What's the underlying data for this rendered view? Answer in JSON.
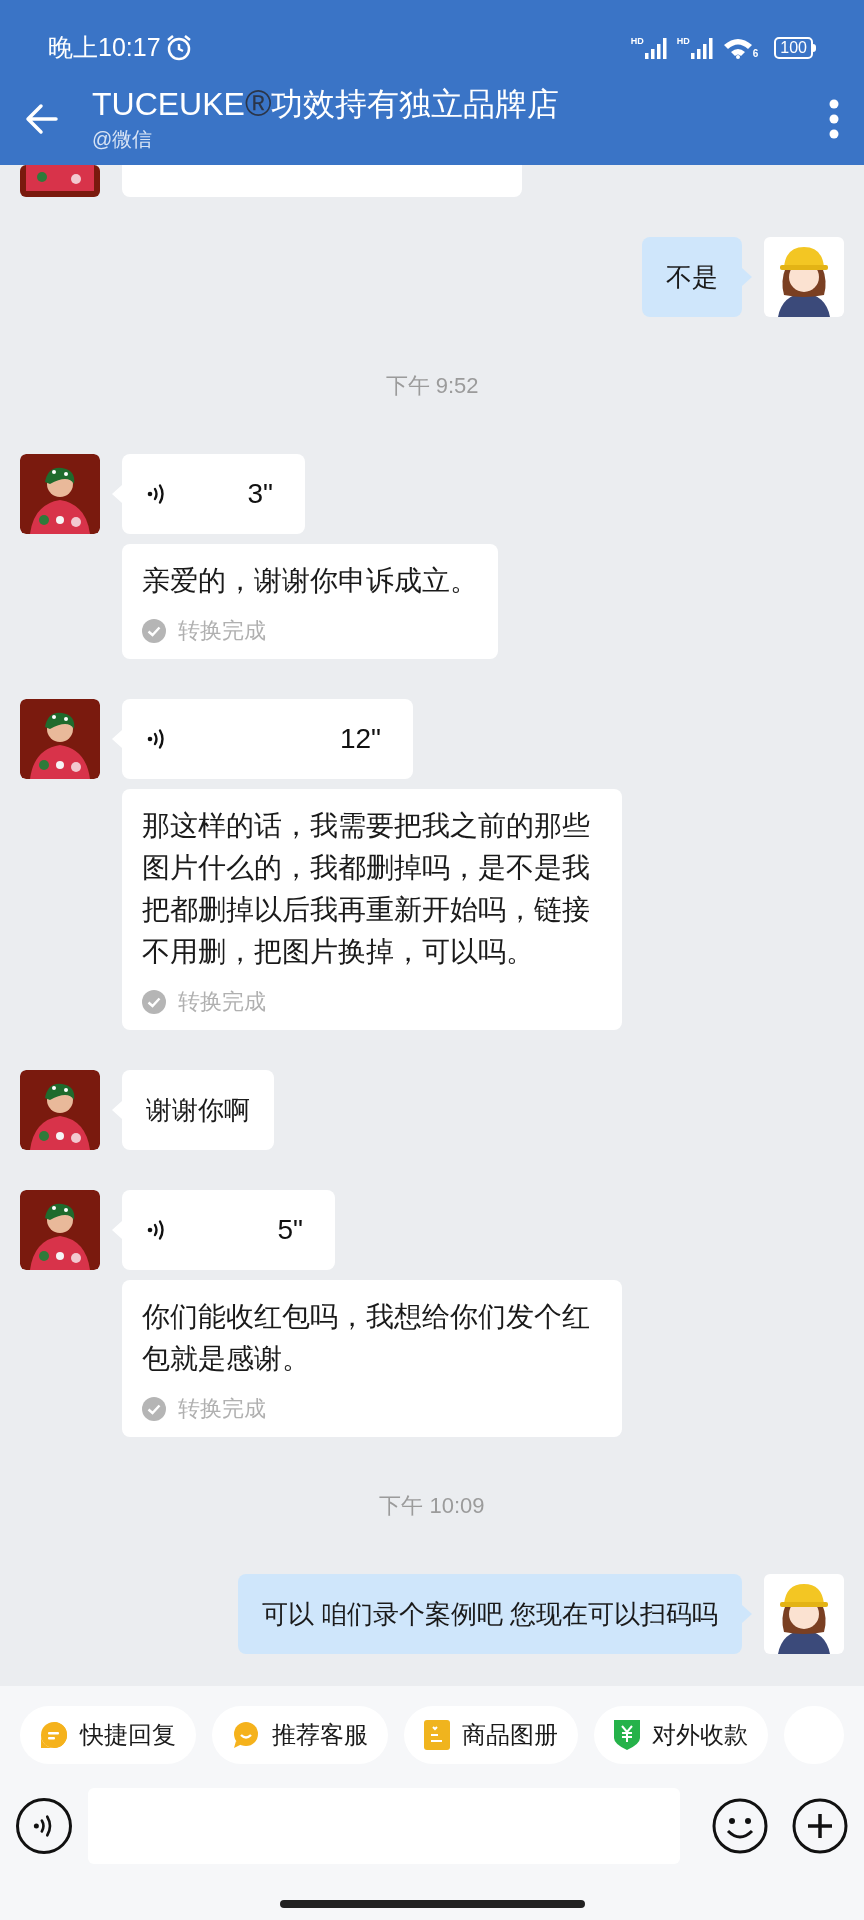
{
  "status_bar": {
    "time": "晚上10:17",
    "signal_labels": [
      "HD",
      "HD"
    ],
    "wifi_label": "6",
    "battery": "100"
  },
  "header": {
    "title": "TUCEUKE",
    "registered_mark": "®",
    "title_rest": "功效持有独立品牌店",
    "subtitle": "@微信"
  },
  "messages": [
    {
      "kind": "cut_off",
      "outgoing": false
    },
    {
      "kind": "text",
      "outgoing": true,
      "text": "不是"
    },
    {
      "kind": "time",
      "text": "下午 9:52"
    },
    {
      "kind": "voice",
      "outgoing": false,
      "duration": "3\"",
      "transcript": {
        "text": "亲爱的，谢谢你申诉成立。",
        "status": "转换完成"
      }
    },
    {
      "kind": "voice",
      "outgoing": false,
      "duration": "12\"",
      "transcript": {
        "text": "那这样的话，我需要把我之前的那些图片什么的，我都删掉吗，是不是我把都删掉以后我再重新开始吗，链接不用删，把图片换掉，可以吗。",
        "status": "转换完成"
      }
    },
    {
      "kind": "text",
      "outgoing": false,
      "text": "谢谢你啊"
    },
    {
      "kind": "voice",
      "outgoing": false,
      "duration": "5\"",
      "transcript": {
        "text": "你们能收红包吗，我想给你们发个红包就是感谢。",
        "status": "转换完成"
      }
    },
    {
      "kind": "time",
      "text": "下午 10:09"
    },
    {
      "kind": "text",
      "outgoing": true,
      "text": "可以 咱们录个案例吧 您现在可以扫码吗"
    }
  ],
  "quick_replies": [
    {
      "kind": "reply",
      "label": "快捷回复"
    },
    {
      "kind": "service",
      "label": "推荐客服"
    },
    {
      "kind": "catalog",
      "label": "商品图册"
    },
    {
      "kind": "payment",
      "label": "对外收款"
    }
  ]
}
